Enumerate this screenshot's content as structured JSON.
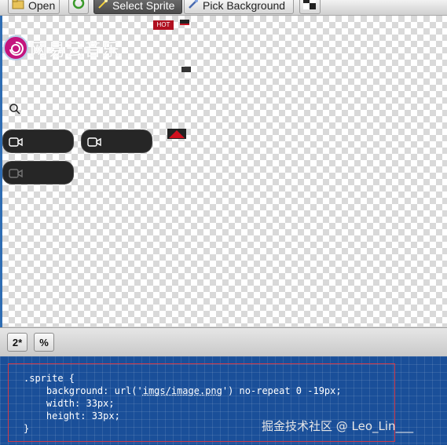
{
  "toolbar": {
    "open_label": "Open",
    "select_sprite_label": "Select Sprite",
    "pick_background_label": "Pick Background"
  },
  "canvas": {
    "hot_badge": "HOT",
    "brand_text": "网易云音乐"
  },
  "bottom_toolbar": {
    "zoom_button_label": "2*",
    "percent_button_label": "%"
  },
  "code_snippet": {
    "line1": ".sprite {",
    "line2_prefix": "    background: url('",
    "line2_link": "imgs/image.png",
    "line2_suffix": "') no-repeat 0 -19px;",
    "line3": "    width: 33px;",
    "line4": "    height: 33px;",
    "line5": "}"
  },
  "watermark": "掘金技术社区 @ Leo_Lin___",
  "colors": {
    "accent_red": "#c4157e",
    "panel_blue": "#1a4f99",
    "hot_red": "#b01020"
  }
}
